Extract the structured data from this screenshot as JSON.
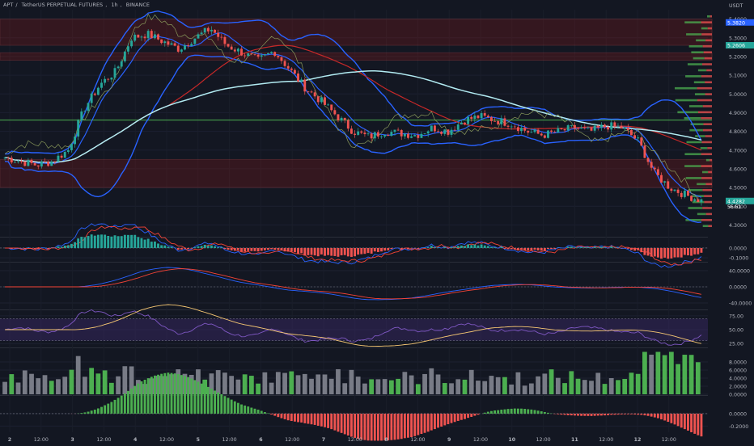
{
  "header": {
    "symbol": "APT",
    "pair": "TetherUS PERPETUAL FUTURES",
    "interval": "1h",
    "exchange": "BINANCE",
    "currency": "USDT"
  },
  "colors": {
    "background": "#131722",
    "up": "#26a69a",
    "down": "#ef5350",
    "band": "#2962ff",
    "ma_slow": "#b2ebf2",
    "ma_mid": "#c62828",
    "zone_fill": "#8b1a1a",
    "green_line": "#4caf50",
    "volume_up": "#4caf50",
    "volume_gray": "#787b86",
    "rsi_band": "#3b2a6b",
    "oscillator_macd": "#2962ff",
    "oscillator_signal": "#f44336"
  },
  "chart_data": [
    {
      "type": "candlestick",
      "x_ticks": [
        "2",
        "12:00",
        "3",
        "12:00",
        "4",
        "12:00",
        "5",
        "12:00",
        "6",
        "12:00",
        "7",
        "12:00",
        "8",
        "12:00",
        "9",
        "12:00",
        "10",
        "12:00",
        "11",
        "12:00",
        "12",
        "12:00"
      ],
      "y_ticks": [
        "5.4000",
        "5.3000",
        "5.2000",
        "5.1000",
        "5.0000",
        "4.9000",
        "4.8000",
        "4.7000",
        "4.6000",
        "4.5000",
        "4.4000",
        "4.3000"
      ],
      "ylim": [
        4.25,
        5.45
      ],
      "price_labels": {
        "last": "4.4282",
        "countdown": "56:51",
        "upper_a": "5.3820",
        "upper_b": "5.2606"
      },
      "price_path": [
        4.66,
        4.64,
        4.62,
        4.64,
        4.7,
        4.92,
        5.05,
        5.12,
        5.3,
        5.32,
        5.28,
        5.24,
        5.3,
        5.35,
        5.26,
        5.22,
        5.18,
        5.23,
        5.13,
        5.03,
        4.96,
        4.88,
        4.8,
        4.77,
        4.8,
        4.79,
        4.78,
        4.82,
        4.8,
        4.86,
        4.88,
        4.86,
        4.84,
        4.8,
        4.78,
        4.8,
        4.82,
        4.8,
        4.83,
        4.82,
        4.75,
        4.58,
        4.5,
        4.46,
        4.43
      ],
      "zones": [
        [
          5.26,
          5.4
        ],
        [
          5.18,
          5.22
        ],
        [
          4.5,
          4.65
        ]
      ],
      "horizontal_lines": [
        4.86
      ]
    },
    {
      "type": "line",
      "y_ticks": [
        "0.0000",
        "-0.1000"
      ],
      "ylim": [
        -0.14,
        0.09
      ]
    },
    {
      "type": "line",
      "y_ticks": [
        "40.0000",
        "0.0000",
        "-40.0000"
      ],
      "ylim": [
        -56,
        56
      ]
    },
    {
      "type": "line",
      "y_ticks": [
        "75.00",
        "50.00",
        "25.00"
      ],
      "ylim": [
        18,
        82
      ],
      "band": [
        30,
        70
      ]
    },
    {
      "type": "bar",
      "y_ticks": [
        "8.0000",
        "6.0000",
        "4.0000",
        "2.0000",
        "0.0000"
      ],
      "ylim": [
        0,
        11
      ]
    },
    {
      "type": "bar",
      "y_ticks": [
        "0.0000",
        "-0.2000"
      ],
      "ylim": [
        -0.3,
        0.26
      ]
    }
  ]
}
